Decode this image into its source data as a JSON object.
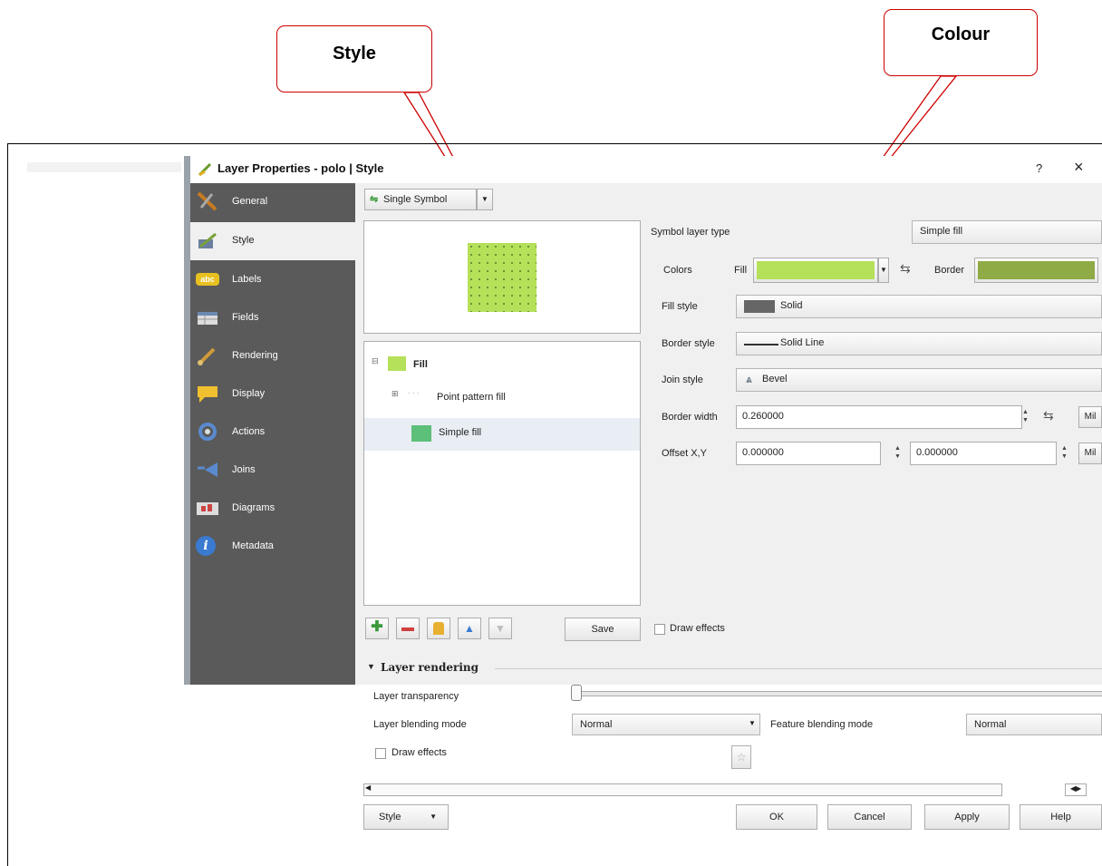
{
  "callouts": {
    "style": "Style",
    "colour": "Colour"
  },
  "window": {
    "title": "Layer Properties - polo | Style",
    "help": "?",
    "close": "×"
  },
  "sidebar": {
    "items": [
      {
        "label": "General"
      },
      {
        "label": "Style"
      },
      {
        "label": "Labels",
        "badge": "abc"
      },
      {
        "label": "Fields"
      },
      {
        "label": "Rendering"
      },
      {
        "label": "Display"
      },
      {
        "label": "Actions"
      },
      {
        "label": "Joins"
      },
      {
        "label": "Diagrams"
      },
      {
        "label": "Metadata",
        "badge": "i"
      }
    ]
  },
  "renderer": {
    "label": "Single Symbol"
  },
  "tree": {
    "fill": "Fill",
    "point_pattern": "Point pattern fill",
    "simple_fill": "Simple fill"
  },
  "props": {
    "symbol_layer_type_label": "Symbol layer type",
    "symbol_layer_type_value": "Simple fill",
    "colors_label": "Colors",
    "fill_label": "Fill",
    "border_label": "Border",
    "fill_color": "#b5e05a",
    "border_color": "#8fab46",
    "fill_style_label": "Fill style",
    "fill_style_value": "Solid",
    "border_style_label": "Border style",
    "border_style_value": "Solid Line",
    "join_style_label": "Join style",
    "join_style_value": "Bevel",
    "border_width_label": "Border width",
    "border_width_value": "0.260000",
    "offset_label": "Offset X,Y",
    "offset_x": "0.000000",
    "offset_y": "0.000000",
    "unit": "Mil"
  },
  "toolbar": {
    "save": "Save",
    "draw_effects": "Draw effects"
  },
  "layer_rendering": {
    "header": "Layer rendering",
    "transparency_label": "Layer transparency",
    "blending_label": "Layer blending mode",
    "blending_value": "Normal",
    "feature_blending_label": "Feature blending mode",
    "feature_blending_value": "Normal",
    "draw_effects": "Draw effects"
  },
  "footer": {
    "style": "Style",
    "ok": "OK",
    "cancel": "Cancel",
    "apply": "Apply",
    "help": "Help"
  },
  "icons": [
    "general-icon",
    "style-icon",
    "labels-icon",
    "fields-icon",
    "rendering-icon",
    "display-icon",
    "actions-icon",
    "joins-icon",
    "diagrams-icon",
    "metadata-icon"
  ]
}
